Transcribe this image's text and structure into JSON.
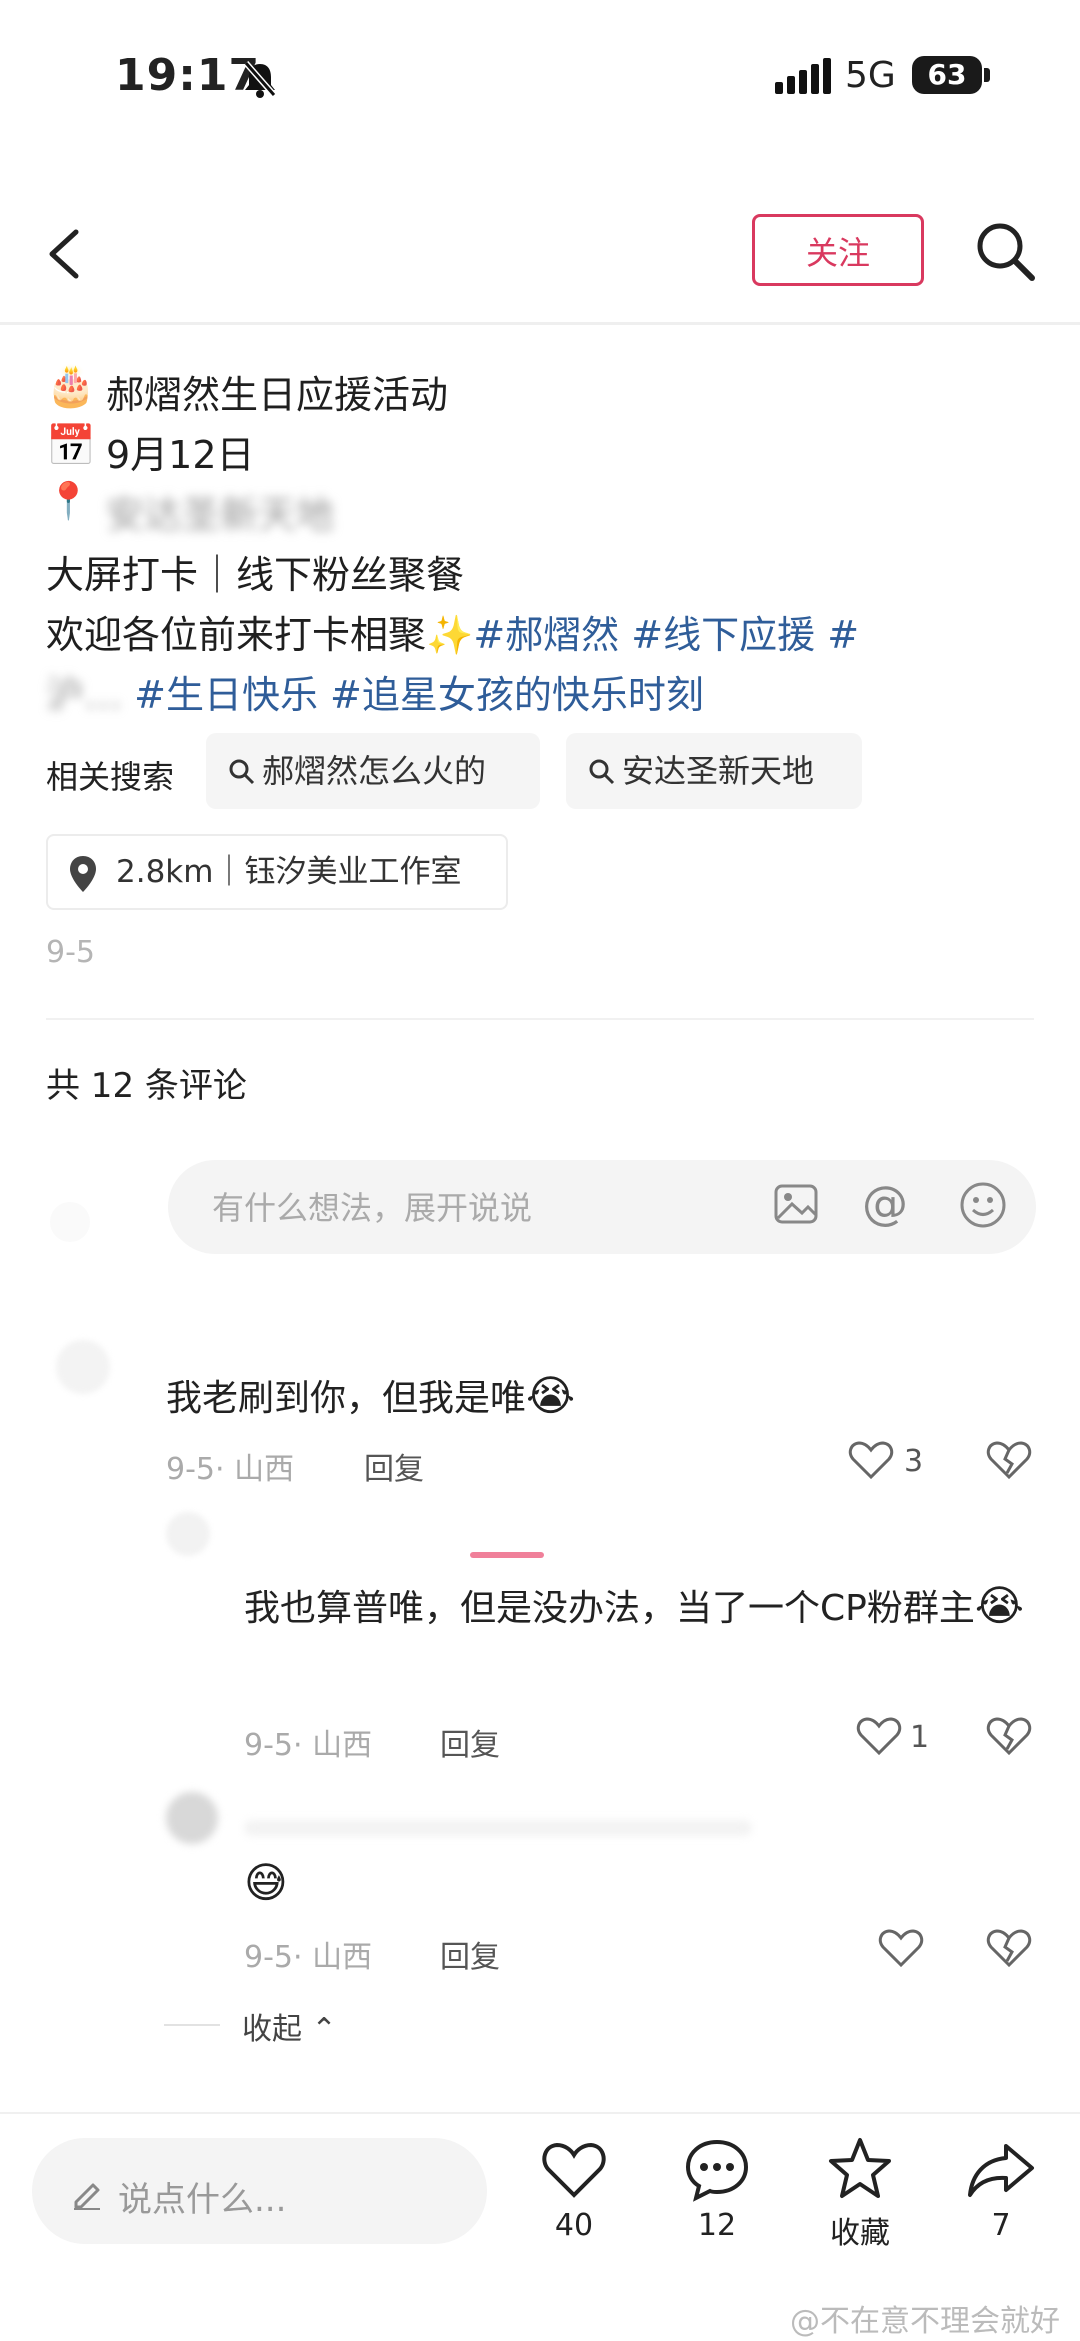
{
  "status_bar": {
    "time": "19:17",
    "network": "5G",
    "battery": "63"
  },
  "header": {
    "follow_label": "关注"
  },
  "post": {
    "line1": "郝熠然生日应援活动",
    "line2": "9月12日",
    "line3_hidden": "安达圣新天地",
    "line4": "大屏打卡｜线下粉丝聚餐",
    "line5_text": "欢迎各位前来打卡相聚",
    "line5_tags": [
      "#郝熠然",
      "#线下应援",
      "#"
    ],
    "line6_tags": [
      "#生日快乐",
      "#追星女孩的快乐时刻"
    ],
    "related_label": "相关搜索",
    "related": [
      "郝熠然怎么火的",
      "安达圣新天地"
    ],
    "location": "2.8km｜钰汐美业工作室",
    "date": "9-5"
  },
  "comments_title": "共 12 条评论",
  "comment_input_placeholder": "有什么想法，展开说说",
  "comments": [
    {
      "text": "我老刷到你，但我是唯",
      "date_region": "9-5· 山西",
      "reply": "回复",
      "likes": "3"
    },
    {
      "text": "我也算普唯，但是没办法，当了一个CP粉群主",
      "date_region": "9-5· 山西",
      "reply": "回复",
      "likes": "1"
    },
    {
      "text": "",
      "date_region": "9-5· 山西",
      "reply": "回复",
      "likes": ""
    }
  ],
  "collapse_label": "收起",
  "bottom_bar": {
    "say_placeholder": "说点什么...",
    "likes": "40",
    "comments": "12",
    "favorite": "收藏",
    "shares": "7"
  },
  "watermark": "@不在意不理会就好"
}
